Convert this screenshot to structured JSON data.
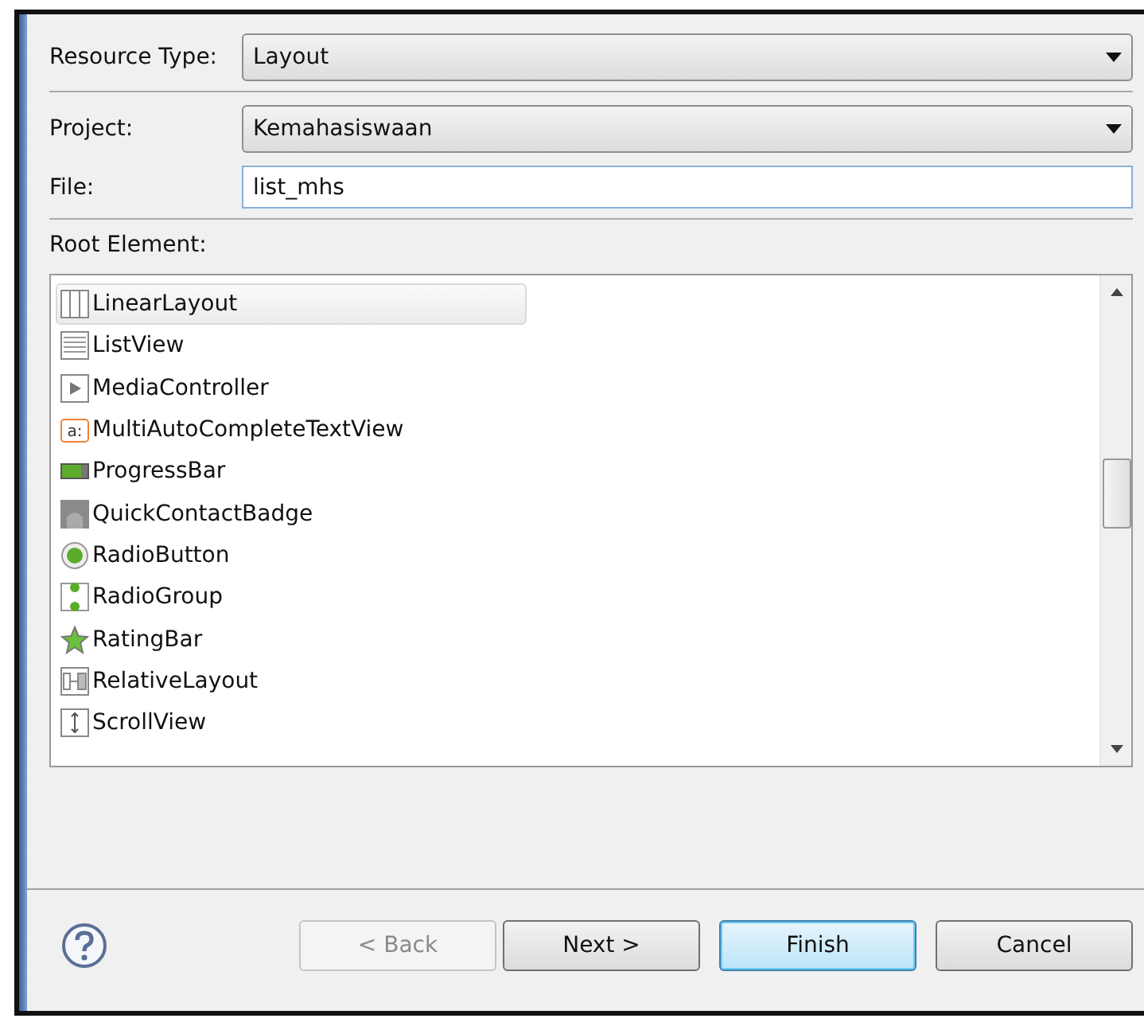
{
  "resource_type": {
    "label": "Resource Type:",
    "value": "Layout"
  },
  "project": {
    "label": "Project:",
    "value": "Kemahasiswaan"
  },
  "file": {
    "label": "File:",
    "value": "list_mhs"
  },
  "root_element": {
    "label": "Root Element:",
    "items": [
      {
        "label": "LinearLayout",
        "kind": "linear",
        "selected": true
      },
      {
        "label": "ListView",
        "kind": "list",
        "selected": false
      },
      {
        "label": "MediaController",
        "kind": "media",
        "selected": false
      },
      {
        "label": "MultiAutoCompleteTextView",
        "kind": "text",
        "icon_text": "a:",
        "selected": false
      },
      {
        "label": "ProgressBar",
        "kind": "progress",
        "selected": false
      },
      {
        "label": "QuickContactBadge",
        "kind": "badge",
        "selected": false
      },
      {
        "label": "RadioButton",
        "kind": "radio",
        "selected": false
      },
      {
        "label": "RadioGroup",
        "kind": "radiogroup",
        "selected": false
      },
      {
        "label": "RatingBar",
        "kind": "rating",
        "selected": false
      },
      {
        "label": "RelativeLayout",
        "kind": "relative",
        "selected": false
      },
      {
        "label": "ScrollView",
        "kind": "scroll",
        "selected": false
      }
    ]
  },
  "buttons": [
    {
      "label": "< Back",
      "disabled": true,
      "default": false
    },
    {
      "label": "Next >",
      "disabled": false,
      "default": false
    },
    {
      "label": "Finish",
      "disabled": false,
      "default": true
    },
    {
      "label": "Cancel",
      "disabled": false,
      "default": false
    }
  ]
}
